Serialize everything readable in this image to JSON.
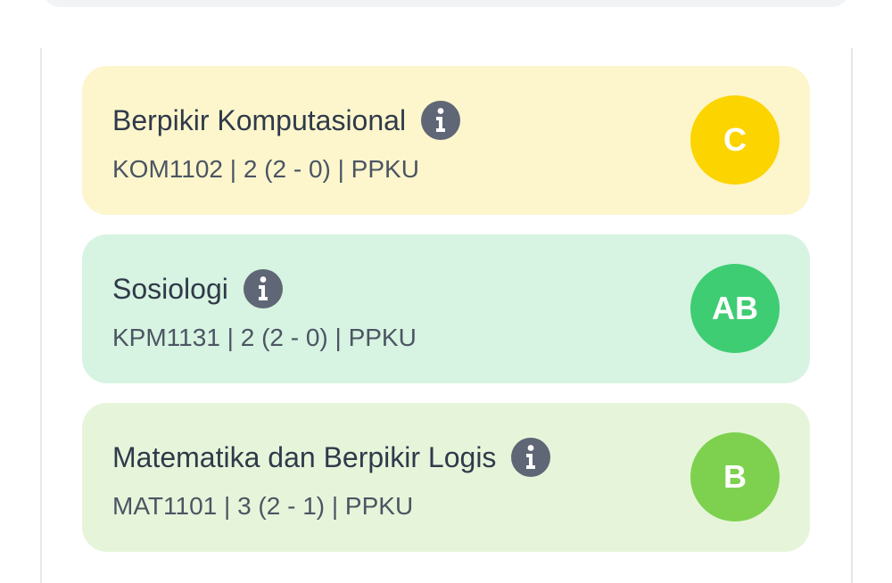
{
  "courses": [
    {
      "title": "Berpikir Komputasional",
      "meta": "KOM1102 | 2 (2 - 0) | PPKU",
      "grade": "C",
      "card_color": "#fdf6cc",
      "grade_color": "#fcd400"
    },
    {
      "title": "Sosiologi",
      "meta": "KPM1131 | 2 (2 - 0) | PPKU",
      "grade": "AB",
      "card_color": "#d7f3e1",
      "grade_color": "#3ecd72"
    },
    {
      "title": "Matematika dan Berpikir Logis",
      "meta": "MAT1101 | 3 (2 - 1) | PPKU",
      "grade": "B",
      "card_color": "#e6f5da",
      "grade_color": "#7ed14e"
    }
  ],
  "icons": {
    "info": "info-circle-icon"
  }
}
